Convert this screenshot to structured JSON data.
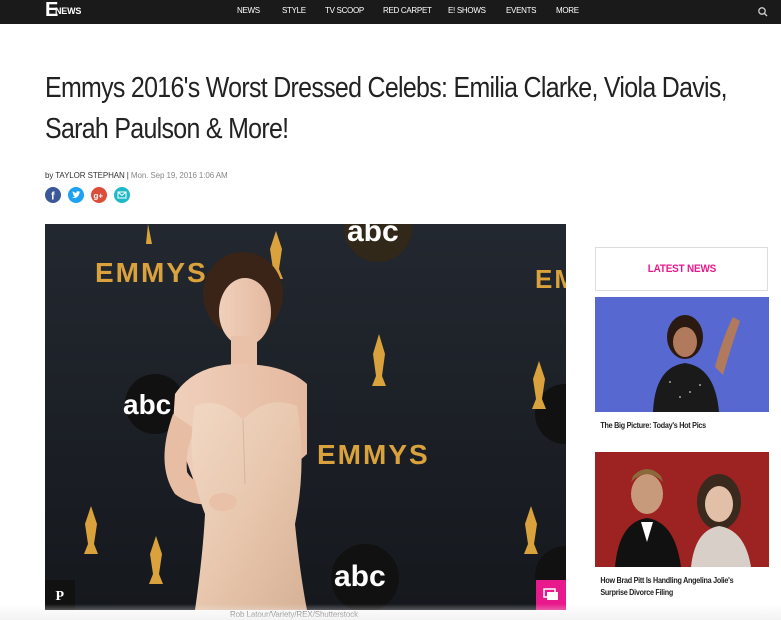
{
  "header": {
    "logo_letter": "E",
    "logo_text": "NEWS",
    "nav_items": [
      "NEWS",
      "STYLE",
      "TV SCOOP",
      "RED CARPET",
      "E! SHOWS",
      "EVENTS",
      "MORE"
    ],
    "search_icon": "search-icon"
  },
  "article": {
    "headline_line1": "Emmys 2016's Worst Dressed Celebs: Emilia Clarke, Viola Davis,",
    "headline_line2": "Sarah Paulson & More!",
    "byline_prefix": "by",
    "author": "TAYLOR STEPHAN",
    "separator": "|",
    "date": "Mon. Sep 19, 2016 1:06 AM",
    "share_icons": [
      "facebook-icon",
      "twitter-icon",
      "google-plus-icon",
      "email-icon"
    ],
    "hero_backdrop_text": [
      "EMMYS",
      "abc",
      "EMMYS",
      "abc",
      "EM"
    ],
    "photo_credit": "Rob Latour/Variety/REX/Shutterstock"
  },
  "sidebar": {
    "title": "LATEST NEWS",
    "items": [
      {
        "caption": "The Big Picture: Today's Hot Pics"
      },
      {
        "caption_line1": "How Brad Pitt Is Handling Angelina Jolie's",
        "caption_line2": "Surprise Divorce Filing"
      }
    ]
  },
  "colors": {
    "brand_pink": "#e8198b",
    "topbar": "#1a1a1a",
    "headline": "#222222",
    "facebook": "#3b5998",
    "twitter": "#1da1f2",
    "google_plus": "#dd4b39",
    "email": "#1fb8c6"
  }
}
